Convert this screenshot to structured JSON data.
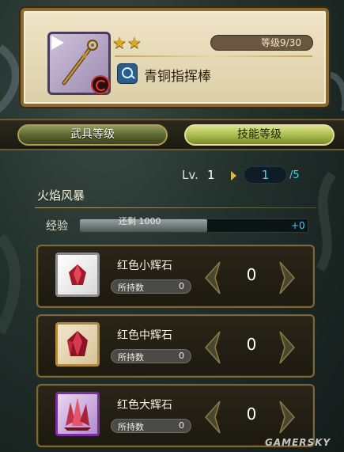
{
  "weapon": {
    "stars": "★★",
    "level_label": "等级",
    "level_value": "9/30",
    "type_icon": "staff-type-icon",
    "name": "青铜指挥棒"
  },
  "tabs": [
    {
      "label": "武具等级",
      "active": false
    },
    {
      "label": "技能等级",
      "active": true
    }
  ],
  "skill": {
    "lv_label": "Lv.",
    "current_level": "1",
    "new_level": "1",
    "max_level": "/5",
    "name": "火焰风暴"
  },
  "exp": {
    "label": "经验",
    "remaining": "还剩 1000",
    "gain": "+0",
    "fill_fraction": 0.56
  },
  "materials": [
    {
      "name": "红色小辉石",
      "owned_label": "所持数",
      "owned": "0",
      "use_count": "0",
      "icon": "red-small-crystal-icon",
      "frame": "gem-small"
    },
    {
      "name": "红色中辉石",
      "owned_label": "所持数",
      "owned": "0",
      "use_count": "0",
      "icon": "red-medium-crystal-icon",
      "frame": "gem-medium"
    },
    {
      "name": "红色大辉石",
      "owned_label": "所持数",
      "owned": "0",
      "use_count": "0",
      "icon": "red-large-crystal-icon",
      "frame": "gem-large"
    }
  ],
  "watermark": "GAMERSKY",
  "colors": {
    "accent_cyan": "#3fd1f2",
    "gold_frame": "#7d6732",
    "active_tab": "#a7b94a"
  }
}
